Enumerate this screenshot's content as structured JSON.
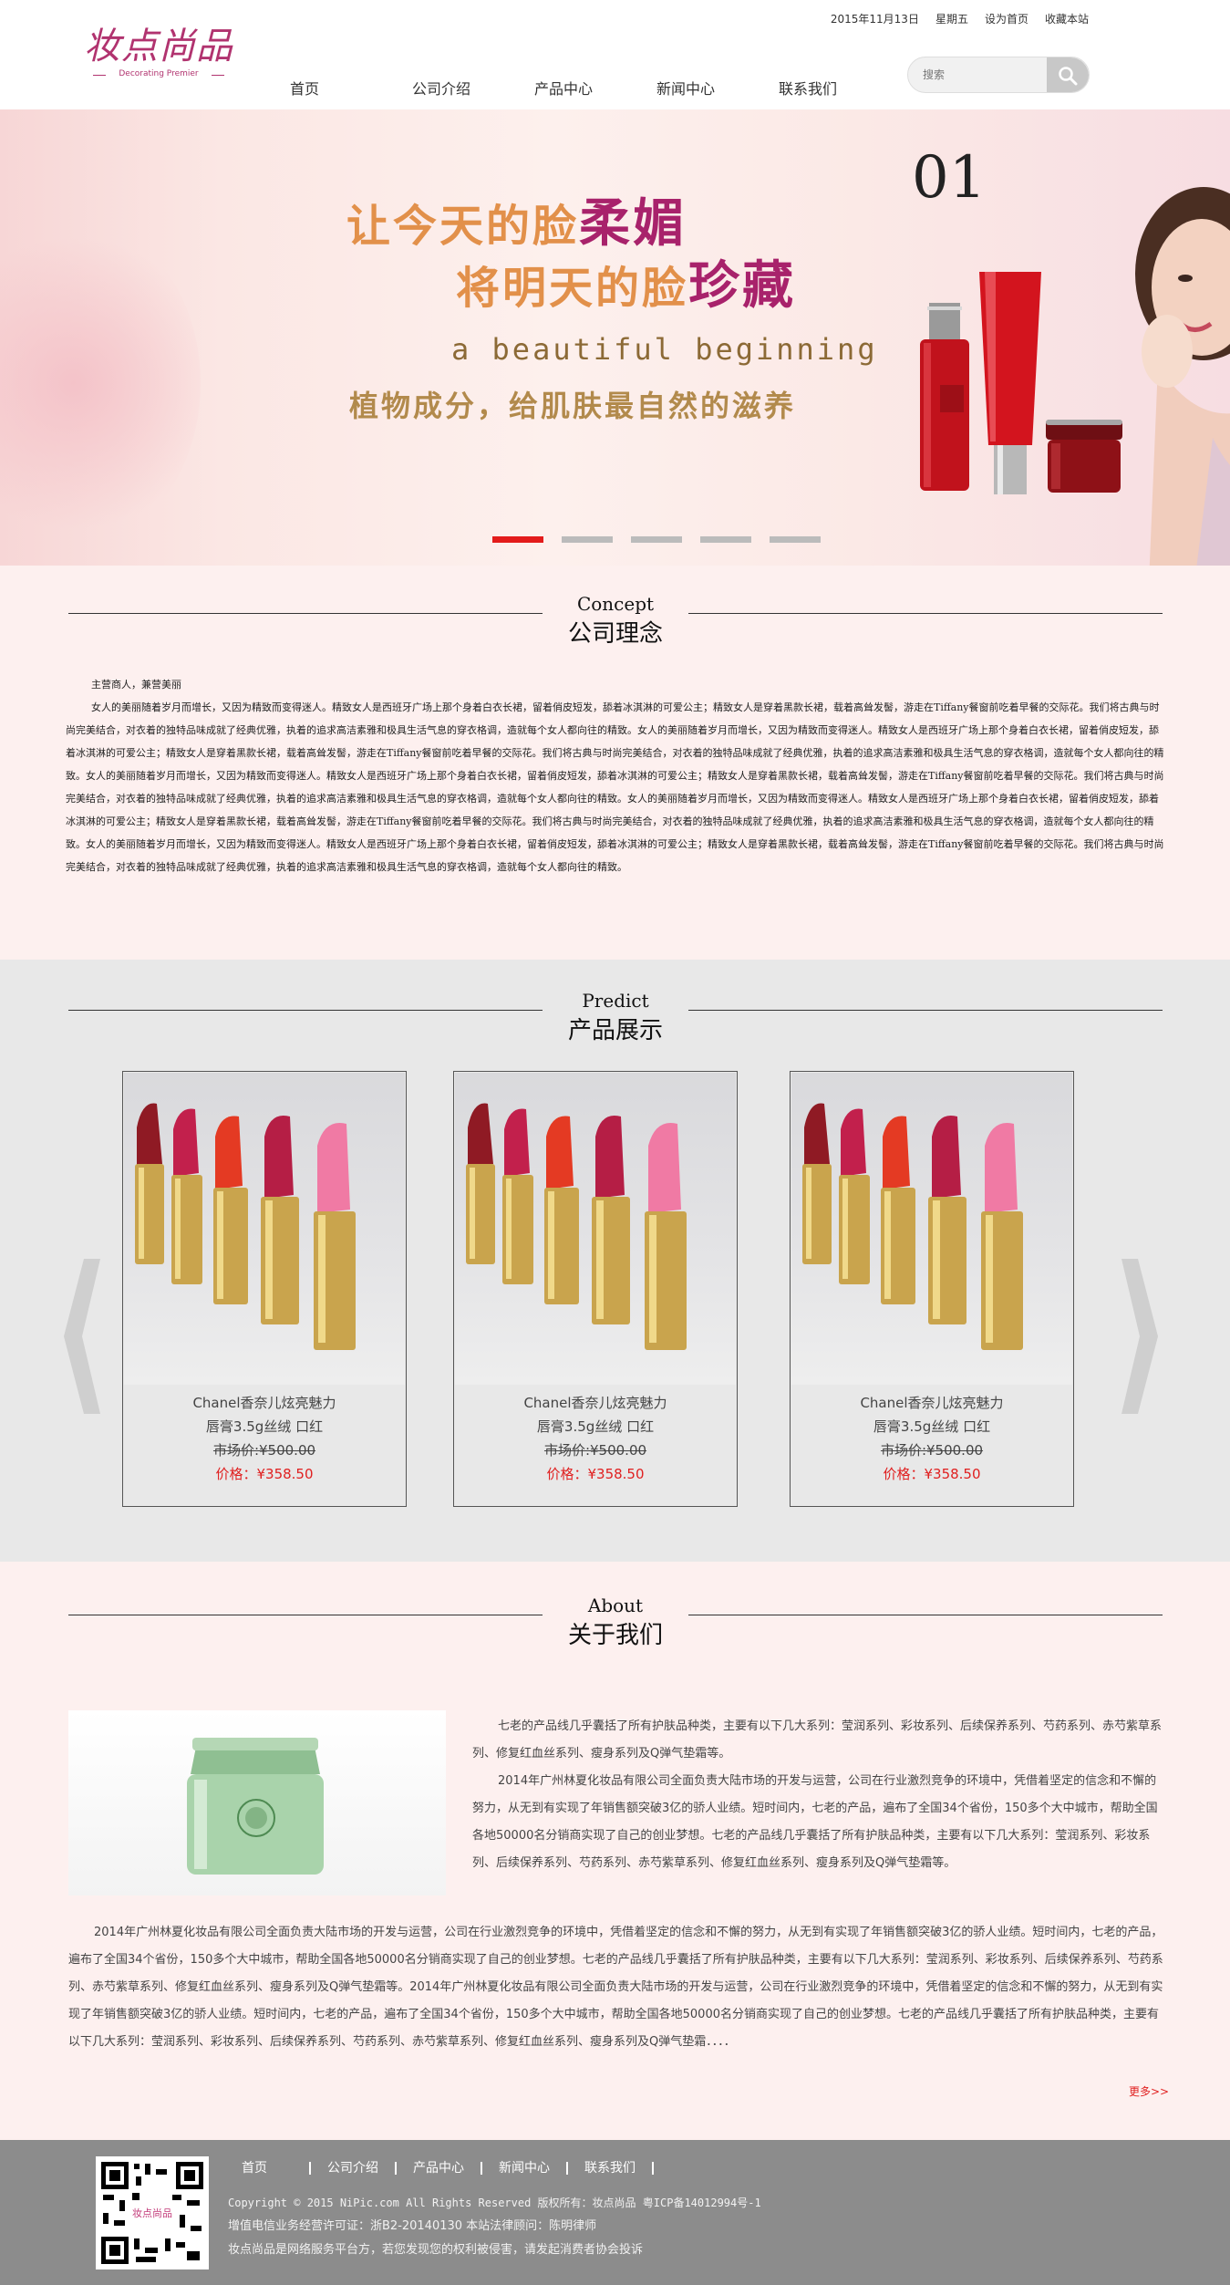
{
  "header": {
    "logo_cn": "妆点尚品",
    "logo_en": "Decorating Premier",
    "date": "2015年11月13日",
    "weekday": "星期五",
    "set_home": "设为首页",
    "bookmark": "收藏本站",
    "nav": [
      "首页",
      "公司介绍",
      "产品中心",
      "新闻中心",
      "联系我们"
    ],
    "search_placeholder": "搜索"
  },
  "banner": {
    "slide_number": "01",
    "line1_a": "让今天的脸",
    "line1_b": "柔媚",
    "line2_a": "将明天的脸",
    "line2_b": "珍藏",
    "line3": "a beautiful beginning",
    "line4": "植物成分，给肌肤最自然的滋养",
    "dots_total": 5,
    "active_dot": 1,
    "colors": {
      "orange": "#e2904a",
      "purple": "#a8226b",
      "active_dot": "#e31b1b"
    }
  },
  "concept": {
    "en": "Concept",
    "cn": "公司理念",
    "lead": "主营商人，兼营美丽",
    "body": "女人的美丽随着岁月而增长，又因为精致而变得迷人。精致女人是西班牙广场上那个身着白衣长裙，留着俏皮短发，舔着冰淇淋的可爱公主；精致女人是穿着黑款长裙，载着高耸发髻，游走在Tiffany餐窗前吃着早餐的交际花。我们将古典与时尚完美结合，对衣着的独特品味成就了经典优雅，执着的追求高洁素雅和极具生活气息的穿衣格调，造就每个女人都向往的精致。女人的美丽随着岁月而增长，又因为精致而变得迷人。精致女人是西班牙广场上那个身着白衣长裙，留着俏皮短发，舔着冰淇淋的可爱公主；精致女人是穿着黑款长裙，载着高耸发髻，游走在Tiffany餐窗前吃着早餐的交际花。我们将古典与时尚完美结合，对衣着的独特品味成就了经典优雅，执着的追求高洁素雅和极具生活气息的穿衣格调，造就每个女人都向往的精致。女人的美丽随着岁月而增长，又因为精致而变得迷人。精致女人是西班牙广场上那个身着白衣长裙，留着俏皮短发，舔着冰淇淋的可爱公主；精致女人是穿着黑款长裙，载着高耸发髻，游走在Tiffany餐窗前吃着早餐的交际花。我们将古典与时尚完美结合，对衣着的独特品味成就了经典优雅，执着的追求高洁素雅和极具生活气息的穿衣格调，造就每个女人都向往的精致。女人的美丽随着岁月而增长，又因为精致而变得迷人。精致女人是西班牙广场上那个身着白衣长裙，留着俏皮短发，舔着冰淇淋的可爱公主；精致女人是穿着黑款长裙，载着高耸发髻，游走在Tiffany餐窗前吃着早餐的交际花。我们将古典与时尚完美结合，对衣着的独特品味成就了经典优雅，执着的追求高洁素雅和极具生活气息的穿衣格调，造就每个女人都向往的精致。女人的美丽随着岁月而增长，又因为精致而变得迷人。精致女人是西班牙广场上那个身着白衣长裙，留着俏皮短发，舔着冰淇淋的可爱公主；精致女人是穿着黑款长裙，载着高耸发髻，游走在Tiffany餐窗前吃着早餐的交际花。我们将古典与时尚完美结合，对衣着的独特品味成就了经典优雅，执着的追求高洁素雅和极具生活气息的穿衣格调，造就每个女人都向往的精致。"
  },
  "products": {
    "en": "Predict",
    "cn": "产品展示",
    "items": [
      {
        "name1": "Chanel香奈儿炫亮魅力",
        "name2": "唇膏3.5g丝绒 口红",
        "market": "市场价:¥500.00",
        "price": "价格：¥358.50"
      },
      {
        "name1": "Chanel香奈儿炫亮魅力",
        "name2": "唇膏3.5g丝绒 口红",
        "market": "市场价:¥500.00",
        "price": "价格：¥358.50"
      },
      {
        "name1": "Chanel香奈儿炫亮魅力",
        "name2": "唇膏3.5g丝绒 口红",
        "market": "市场价:¥500.00",
        "price": "价格：¥358.50"
      }
    ]
  },
  "about": {
    "en": "About",
    "cn": "关于我们",
    "side_p1": "七老的产品线几乎囊括了所有护肤品种类，主要有以下几大系列：莹润系列、彩妆系列、后续保养系列、芍药系列、赤芍紫草系列、修复红血丝系列、瘦身系列及Q弹气垫霜等。",
    "side_p2": "2014年广州林夏化妆品有限公司全面负责大陆市场的开发与运营，公司在行业激烈竞争的环境中，凭借着坚定的信念和不懈的努力，从无到有实现了年销售额突破3亿的骄人业绩。短时间内，七老的产品，遍布了全国34个省份，150多个大中城市，帮助全国各地50000名分销商实现了自己的创业梦想。七老的产品线几乎囊括了所有护肤品种类，主要有以下几大系列：莹润系列、彩妆系列、后续保养系列、芍药系列、赤芍紫草系列、修复红血丝系列、瘦身系列及Q弹气垫霜等。",
    "full": "2014年广州林夏化妆品有限公司全面负责大陆市场的开发与运营，公司在行业激烈竞争的环境中，凭借着坚定的信念和不懈的努力，从无到有实现了年销售额突破3亿的骄人业绩。短时间内，七老的产品，遍布了全国34个省份，150多个大中城市，帮助全国各地50000名分销商实现了自己的创业梦想。七老的产品线几乎囊括了所有护肤品种类，主要有以下几大系列：莹润系列、彩妆系列、后续保养系列、芍药系列、赤芍紫草系列、修复红血丝系列、瘦身系列及Q弹气垫霜等。2014年广州林夏化妆品有限公司全面负责大陆市场的开发与运营，公司在行业激烈竞争的环境中，凭借着坚定的信念和不懈的努力，从无到有实现了年销售额突破3亿的骄人业绩。短时间内，七老的产品，遍布了全国34个省份，150多个大中城市，帮助全国各地50000名分销商实现了自己的创业梦想。七老的产品线几乎囊括了所有护肤品种类，主要有以下几大系列：莹润系列、彩妆系列、后续保养系列、芍药系列、赤芍紫草系列、修复红血丝系列、瘦身系列及Q弹气垫霜．．．．",
    "more": "更多>>"
  },
  "footer": {
    "nav": [
      "首页",
      "公司介绍",
      "产品中心",
      "新闻中心",
      "联系我们"
    ],
    "copyright": "Copyright © 2015 NiPic.com All Rights Reserved  版权所有：妆点尚品   粤ICP备14012994号-1",
    "license": "增值电信业务经营许可证：浙B2-20140130 本站法律顾问：陈明律师",
    "notice": "妆点尚品是网络服务平台方，若您发现您的权利被侵害，请发起消费者协会投诉",
    "qr_label": "妆点尚品"
  }
}
